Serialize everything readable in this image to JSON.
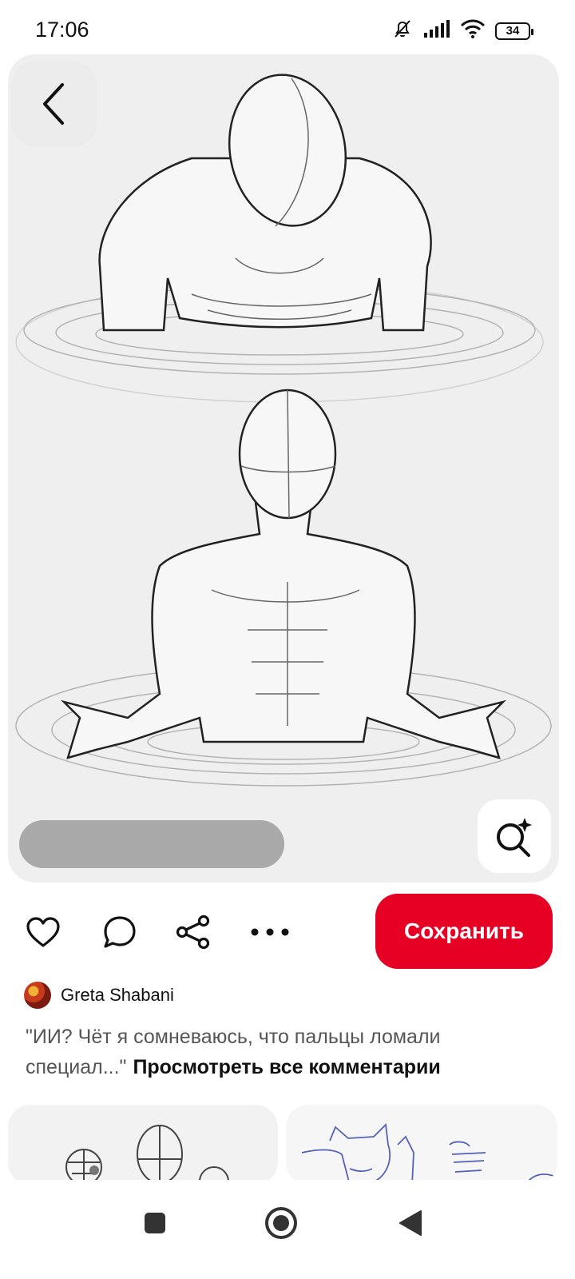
{
  "status_bar": {
    "time": "17:06",
    "battery": "34",
    "icons": [
      "bell-off-icon",
      "signal-icon",
      "wifi-icon",
      "battery-icon"
    ]
  },
  "pin": {
    "image_description_icon": "figure-drawing-image",
    "back_icon": "chevron-left-icon",
    "visual_search_icon": "lens-sparkle-icon"
  },
  "actions": {
    "icons": [
      "heart-icon",
      "comment-icon",
      "share-icon",
      "more-icon"
    ],
    "save_label": "Сохранить"
  },
  "author": {
    "name": "Greta Shabani"
  },
  "comment": {
    "text": "\"ИИ? Чёт я сомневаюсь, что пальцы ломали специал...\"",
    "view_all": "Просмотреть все комментарии"
  },
  "nav_bar": {
    "icons": [
      "recent-apps-icon",
      "home-icon",
      "back-icon"
    ]
  },
  "colors": {
    "accent": "#e60023",
    "card_bg": "#efefef"
  }
}
